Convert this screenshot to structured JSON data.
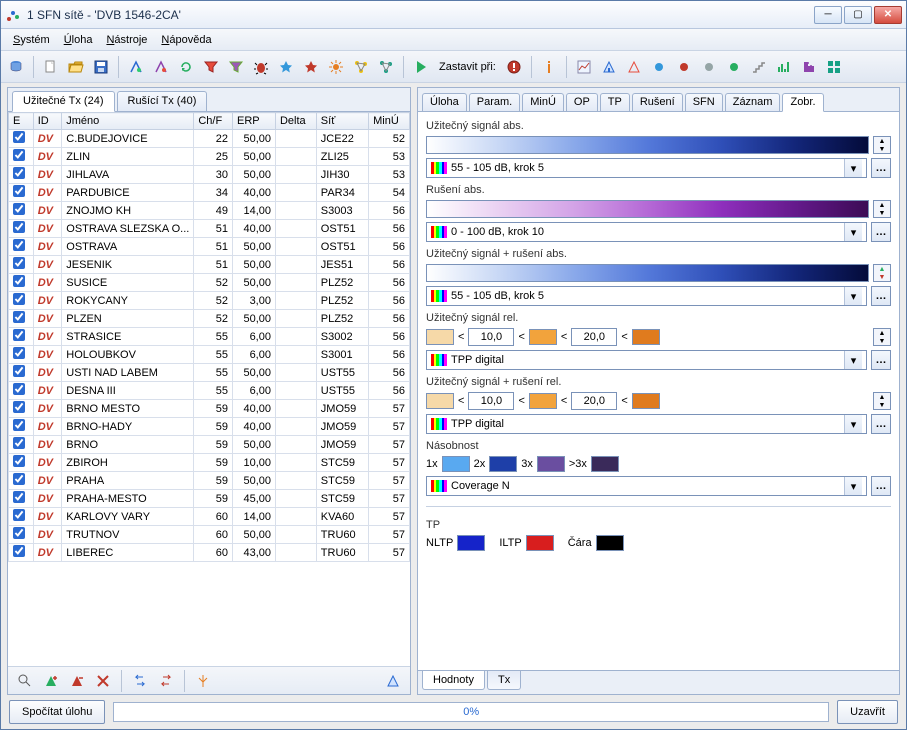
{
  "window": {
    "title": "1 SFN sítě - 'DVB 1546-2CA'"
  },
  "menu": {
    "system": "Systém",
    "uloha": "Úloha",
    "nastroje": "Nástroje",
    "napoveda": "Nápověda"
  },
  "toolbar": {
    "stop_label": "Zastavit při:"
  },
  "left": {
    "tabs": {
      "useful": "Užitečné Tx (24)",
      "interf": "Rušící Tx (40)"
    },
    "headers": {
      "e": "E",
      "id": "ID",
      "name": "Jméno",
      "chf": "Ch/F",
      "erp": "ERP",
      "delta": "Delta",
      "sit": "Síť",
      "minu": "MinÚ"
    },
    "rows": [
      {
        "name": "C.BUDEJOVICE",
        "ch": "22",
        "erp": "50,00",
        "delta": "",
        "sit": "JCE22",
        "minu": "52"
      },
      {
        "name": "ZLIN",
        "ch": "25",
        "erp": "50,00",
        "delta": "",
        "sit": "ZLI25",
        "minu": "53"
      },
      {
        "name": "JIHLAVA",
        "ch": "30",
        "erp": "50,00",
        "delta": "",
        "sit": "JIH30",
        "minu": "53"
      },
      {
        "name": "PARDUBICE",
        "ch": "34",
        "erp": "40,00",
        "delta": "",
        "sit": "PAR34",
        "minu": "54"
      },
      {
        "name": "ZNOJMO KH",
        "ch": "49",
        "erp": "14,00",
        "delta": "",
        "sit": "S3003",
        "minu": "56"
      },
      {
        "name": "OSTRAVA SLEZSKA O...",
        "ch": "51",
        "erp": "40,00",
        "delta": "",
        "sit": "OST51",
        "minu": "56"
      },
      {
        "name": "OSTRAVA",
        "ch": "51",
        "erp": "50,00",
        "delta": "",
        "sit": "OST51",
        "minu": "56"
      },
      {
        "name": "JESENIK",
        "ch": "51",
        "erp": "50,00",
        "delta": "",
        "sit": "JES51",
        "minu": "56"
      },
      {
        "name": "SUSICE",
        "ch": "52",
        "erp": "50,00",
        "delta": "",
        "sit": "PLZ52",
        "minu": "56"
      },
      {
        "name": "ROKYCANY",
        "ch": "52",
        "erp": "3,00",
        "delta": "",
        "sit": "PLZ52",
        "minu": "56"
      },
      {
        "name": "PLZEN",
        "ch": "52",
        "erp": "50,00",
        "delta": "",
        "sit": "PLZ52",
        "minu": "56"
      },
      {
        "name": "STRASICE",
        "ch": "55",
        "erp": "6,00",
        "delta": "",
        "sit": "S3002",
        "minu": "56"
      },
      {
        "name": "HOLOUBKOV",
        "ch": "55",
        "erp": "6,00",
        "delta": "",
        "sit": "S3001",
        "minu": "56"
      },
      {
        "name": "USTI NAD LABEM",
        "ch": "55",
        "erp": "50,00",
        "delta": "",
        "sit": "UST55",
        "minu": "56"
      },
      {
        "name": "DESNA III",
        "ch": "55",
        "erp": "6,00",
        "delta": "",
        "sit": "UST55",
        "minu": "56"
      },
      {
        "name": "BRNO MESTO",
        "ch": "59",
        "erp": "40,00",
        "delta": "",
        "sit": "JMO59",
        "minu": "57"
      },
      {
        "name": "BRNO-HADY",
        "ch": "59",
        "erp": "40,00",
        "delta": "",
        "sit": "JMO59",
        "minu": "57"
      },
      {
        "name": "BRNO",
        "ch": "59",
        "erp": "50,00",
        "delta": "",
        "sit": "JMO59",
        "minu": "57"
      },
      {
        "name": "ZBIROH",
        "ch": "59",
        "erp": "10,00",
        "delta": "",
        "sit": "STC59",
        "minu": "57"
      },
      {
        "name": "PRAHA",
        "ch": "59",
        "erp": "50,00",
        "delta": "",
        "sit": "STC59",
        "minu": "57"
      },
      {
        "name": "PRAHA-MESTO",
        "ch": "59",
        "erp": "45,00",
        "delta": "",
        "sit": "STC59",
        "minu": "57"
      },
      {
        "name": "KARLOVY VARY",
        "ch": "60",
        "erp": "14,00",
        "delta": "",
        "sit": "KVA60",
        "minu": "57"
      },
      {
        "name": "TRUTNOV",
        "ch": "60",
        "erp": "50,00",
        "delta": "",
        "sit": "TRU60",
        "minu": "57"
      },
      {
        "name": "LIBEREC",
        "ch": "60",
        "erp": "43,00",
        "delta": "",
        "sit": "TRU60",
        "minu": "57"
      }
    ]
  },
  "right": {
    "tabs": {
      "uloha": "Úloha",
      "param": "Param.",
      "minu": "MinÚ",
      "op": "OP",
      "tp": "TP",
      "ruseni": "Rušení",
      "sfn": "SFN",
      "zaznam": "Záznam",
      "zobr": "Zobr."
    },
    "sec_useful_abs": "Užitečný signál abs.",
    "dd_useful_abs": "55 - 105 dB, krok 5",
    "sec_interf_abs": "Rušení abs.",
    "dd_interf_abs": "0 - 100 dB, krok 10",
    "sec_combo_abs": "Užitečný signál + rušení abs.",
    "dd_combo_abs": "55 - 105 dB, krok 5",
    "sec_useful_rel": "Užitečný signál rel.",
    "rel_low": "10,0",
    "rel_high": "20,0",
    "dd_tpp1": "TPP digital",
    "sec_combo_rel": "Užitečný signál + rušení rel.",
    "dd_tpp2": "TPP digital",
    "sec_mult": "Násobnost",
    "mult_1": "1x",
    "mult_2": "2x",
    "mult_3": "3x",
    "mult_g3": ">3x",
    "dd_cov": "Coverage N",
    "sec_tp": "TP",
    "tp_nltp": "NLTP",
    "tp_iltp": "ILTP",
    "tp_line": "Čára",
    "btabs": {
      "hodnoty": "Hodnoty",
      "tx": "Tx"
    }
  },
  "footer": {
    "compute": "Spočítat úlohu",
    "progress": "0%",
    "close": "Uzavřít"
  },
  "colors": {
    "blue_grad": [
      "#ffffff",
      "#c7d7f5",
      "#8aa9ea",
      "#5479da",
      "#2f4fb8",
      "#13267a",
      "#040b3a"
    ],
    "purple_grad": [
      "#ffffff",
      "#e9d0f2",
      "#d3a3e7",
      "#b569d6",
      "#8f2fbd",
      "#651a8c",
      "#3c0b55"
    ],
    "orange_light": "#f6d9a8",
    "orange_mid": "#f2a33c",
    "orange_dark": "#e07b1e",
    "mult1": "#59a9f0",
    "mult2": "#1e3fa8",
    "mult3": "#6a4ea0",
    "multg3": "#3a2a5a",
    "nltp": "#1523c9",
    "iltp": "#d81e1e",
    "line_black": "#000000"
  }
}
